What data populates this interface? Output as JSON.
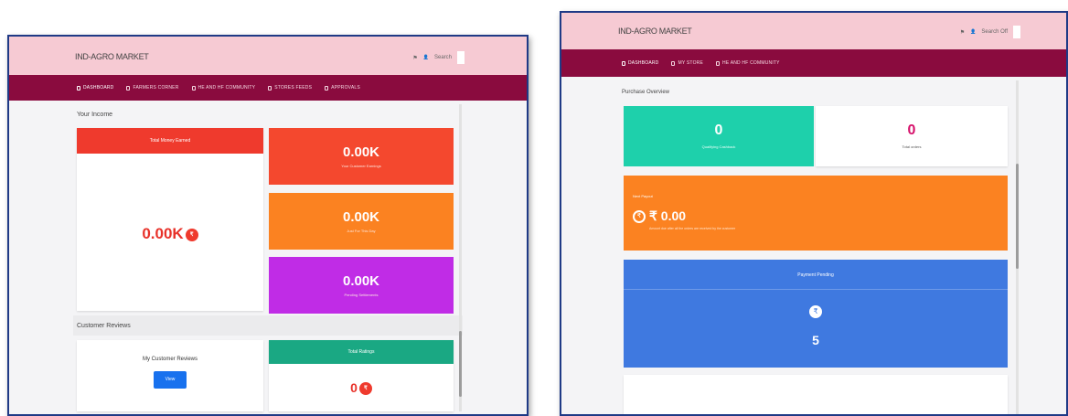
{
  "left": {
    "brand": "IND-AGRO MARKET",
    "top_right": {
      "icon1": "⚑",
      "icon2": "👤",
      "search": "Search"
    },
    "nav": [
      "DASHBOARD",
      "FARMERS CORNER",
      "HE AND HF COMMUNITY",
      "STORES FEEDS",
      "APPROVALS"
    ],
    "income_label": "Your Income",
    "total_header": "Total Money Earned",
    "total_value": "0.00K",
    "coin_symbol": "₹",
    "cards": [
      {
        "value": "0.00K",
        "sub": "Your Customer Earnings"
      },
      {
        "value": "0.00K",
        "sub": "Just For This Day"
      },
      {
        "value": "0.00K",
        "sub": "Pending Settlements"
      }
    ],
    "reviews_label": "Customer Reviews",
    "my_reviews_title": "My Customer Reviews",
    "view_button": "View",
    "total_ratings_header": "Total Ratings",
    "total_ratings_value": "0"
  },
  "right": {
    "brand": "IND-AGRO MARKET",
    "top_right": {
      "icon1": "⚑",
      "icon2": "👤",
      "search": "Search Off"
    },
    "nav": [
      "DASHBOARD",
      "MY STORE",
      "HE AND HF COMMUNITY"
    ],
    "overview_label": "Purchase Overview",
    "card1": {
      "value": "0",
      "sub": "Qualifying Cashback"
    },
    "card2": {
      "value": "0",
      "sub": "Total orders"
    },
    "payout": {
      "header": "Next Payout",
      "value": "₹ 0.00",
      "sub": "Amount due after all the orders are received by the customer"
    },
    "pending": {
      "header": "Payment Pending",
      "value": "5"
    }
  },
  "colors": {
    "topbar": "#f6cad3",
    "navbar": "#8a0b3e",
    "red": "#ef3a2d",
    "orange": "#fb8221",
    "purple": "#c02ce6",
    "green": "#1aa883",
    "teal": "#1ed0ab",
    "blue": "#3f79e0",
    "view_button": "#1871ee"
  }
}
